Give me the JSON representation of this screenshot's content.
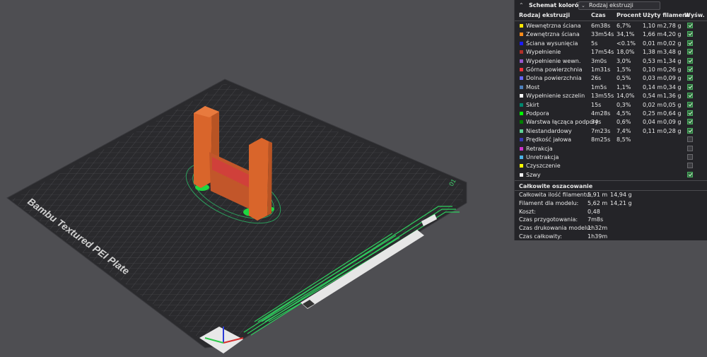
{
  "plate": {
    "label": "Bambu Textured PEI Plate",
    "number": "01"
  },
  "legend": {
    "title": "Schemat kolorów",
    "view_type": "Rodzaj ekstruzji",
    "columns": [
      "Rodzaj ekstruzji",
      "Czas",
      "Procent",
      "Użyty filament",
      "Wyśw."
    ],
    "rows": [
      {
        "name": "Wewnętrzna ściana",
        "color": "#ffe600",
        "time": "6m38s",
        "percent": "6,7%",
        "length": "1,10 m",
        "weight": "2,78 g",
        "visible": true
      },
      {
        "name": "Zewnętrzna ściana",
        "color": "#ff8c1a",
        "time": "33m54s",
        "percent": "34,1%",
        "length": "1,66 m",
        "weight": "4,20 g",
        "visible": true
      },
      {
        "name": "Ściana wysunięcia",
        "color": "#1a1aff",
        "time": "5s",
        "percent": "<0.1%",
        "length": "0,01 m",
        "weight": "0,02 g",
        "visible": true
      },
      {
        "name": "Wypełnienie",
        "color": "#b03029",
        "time": "17m54s",
        "percent": "18,0%",
        "length": "1,38 m",
        "weight": "3,48 g",
        "visible": true
      },
      {
        "name": "Wypełnienie wewn.",
        "color": "#9457cc",
        "time": "3m0s",
        "percent": "3,0%",
        "length": "0,53 m",
        "weight": "1,34 g",
        "visible": true
      },
      {
        "name": "Górna powierzchnia",
        "color": "#f0323c",
        "time": "1m31s",
        "percent": "1,5%",
        "length": "0,10 m",
        "weight": "0,26 g",
        "visible": true
      },
      {
        "name": "Dolna powierzchnia",
        "color": "#6666ff",
        "time": "26s",
        "percent": "0,5%",
        "length": "0,03 m",
        "weight": "0,09 g",
        "visible": true
      },
      {
        "name": "Most",
        "color": "#4d80ba",
        "time": "1m5s",
        "percent": "1,1%",
        "length": "0,14 m",
        "weight": "0,34 g",
        "visible": true
      },
      {
        "name": "Wypełnienie szczelin",
        "color": "#ffffff",
        "time": "13m55s",
        "percent": "14,0%",
        "length": "0,54 m",
        "weight": "1,36 g",
        "visible": true
      },
      {
        "name": "Skirt",
        "color": "#00876e",
        "time": "15s",
        "percent": "0,3%",
        "length": "0,02 m",
        "weight": "0,05 g",
        "visible": true
      },
      {
        "name": "Podpora",
        "color": "#00ff00",
        "time": "4m28s",
        "percent": "4,5%",
        "length": "0,25 m",
        "weight": "0,64 g",
        "visible": true
      },
      {
        "name": "Warstwa łącząca podpory",
        "color": "#008000",
        "time": "34s",
        "percent": "0,6%",
        "length": "0,04 m",
        "weight": "0,09 g",
        "visible": true
      },
      {
        "name": "Niestandardowy",
        "color": "#5ed194",
        "time": "7m23s",
        "percent": "7,4%",
        "length": "0,11 m",
        "weight": "0,28 g",
        "visible": true
      },
      {
        "name": "Prędkość jałowa",
        "color": "#3a3ab4",
        "time": "8m25s",
        "percent": "8,5%",
        "length": "",
        "weight": "",
        "visible": false
      },
      {
        "name": "Retrakcja",
        "color": "#cc33cc",
        "time": "",
        "percent": "",
        "length": "",
        "weight": "",
        "visible": false
      },
      {
        "name": "Unretrakcja",
        "color": "#4db3e6",
        "time": "",
        "percent": "",
        "length": "",
        "weight": "",
        "visible": false
      },
      {
        "name": "Czyszczenie",
        "color": "#ffff00",
        "time": "",
        "percent": "",
        "length": "",
        "weight": "",
        "visible": false
      },
      {
        "name": "Szwy",
        "color": "#f0f0f0",
        "time": "",
        "percent": "",
        "length": "",
        "weight": "",
        "visible": true
      }
    ]
  },
  "estimation": {
    "title": "Całkowite oszacowanie",
    "rows": [
      {
        "label": "Całkowita ilość filamentu:",
        "v1": "5,91 m",
        "v2": "14,94 g"
      },
      {
        "label": "Filament dla modelu:",
        "v1": "5,62 m",
        "v2": "14,21 g"
      },
      {
        "label": "Koszt:",
        "v1": "0,48",
        "v2": ""
      },
      {
        "label": "Czas przygotowania:",
        "v1": "7m8s",
        "v2": ""
      },
      {
        "label": "Czas drukowania modelu:",
        "v1": "1h32m",
        "v2": ""
      },
      {
        "label": "Czas całkowity:",
        "v1": "1h39m",
        "v2": ""
      }
    ]
  }
}
